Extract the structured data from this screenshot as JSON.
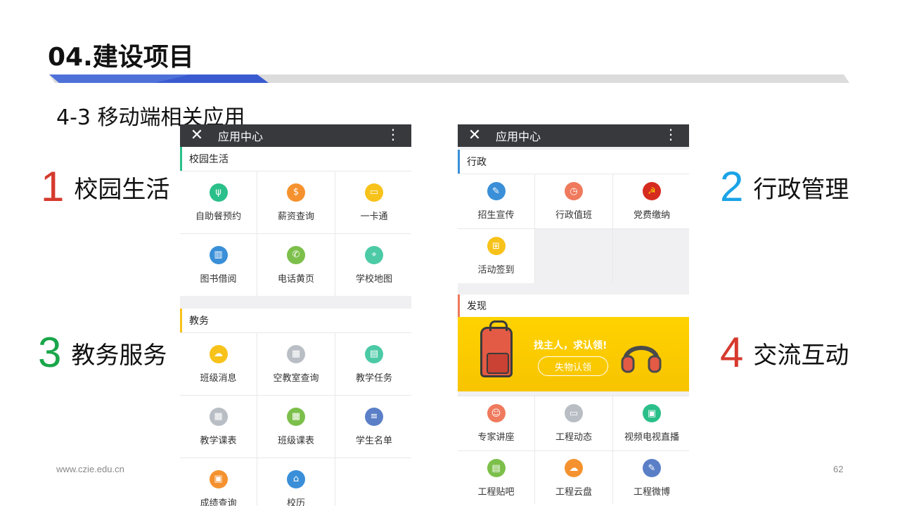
{
  "slide": {
    "title": "04.建设项目",
    "subtitle": "4-3 移动端相关应用",
    "footer_url": "www.czie.edu.cn",
    "page_number": "62"
  },
  "categories": [
    {
      "num": "1",
      "label": "校园生活",
      "color": "#d63a2e"
    },
    {
      "num": "2",
      "label": "行政管理",
      "color": "#1ba3e6"
    },
    {
      "num": "3",
      "label": "教务服务",
      "color": "#1aa64a"
    },
    {
      "num": "4",
      "label": "交流互动",
      "color": "#d63a2e"
    }
  ],
  "left_phone": {
    "header_title": "应用中心",
    "sections": [
      {
        "title": "校园生活",
        "accent": "#2bbf8a",
        "items": [
          {
            "label": "自助餐预约",
            "icon": "fork-icon",
            "color": "#2bbf8a"
          },
          {
            "label": "薪资查询",
            "icon": "coin-icon",
            "color": "#f5922f"
          },
          {
            "label": "一卡通",
            "icon": "card-icon",
            "color": "#f7c21a"
          },
          {
            "label": "图书借阅",
            "icon": "book-icon",
            "color": "#3a8fd8"
          },
          {
            "label": "电话黄页",
            "icon": "phone-icon",
            "color": "#7cbf4a"
          },
          {
            "label": "学校地图",
            "icon": "map-pin-icon",
            "color": "#4ccaa6"
          }
        ]
      },
      {
        "title": "教务",
        "accent": "#f7c21a",
        "items": [
          {
            "label": "班级消息",
            "icon": "chat-icon",
            "color": "#f7c21a"
          },
          {
            "label": "空教室查询",
            "icon": "building-icon",
            "color": "#b9bec5"
          },
          {
            "label": "教学任务",
            "icon": "clipboard-icon",
            "color": "#4ccaa6"
          },
          {
            "label": "教学课表",
            "icon": "table-icon",
            "color": "#b9bec5"
          },
          {
            "label": "班级课表",
            "icon": "calendar-icon",
            "color": "#7cbf4a"
          },
          {
            "label": "学生名单",
            "icon": "list-icon",
            "color": "#5a7fc7"
          },
          {
            "label": "成绩查询",
            "icon": "grade-icon",
            "color": "#f5922f"
          },
          {
            "label": "校历",
            "icon": "school-icon",
            "color": "#3a8fd8"
          }
        ]
      }
    ]
  },
  "right_phone": {
    "header_title": "应用中心",
    "admin_section": {
      "title": "行政",
      "accent": "#3a8fd8",
      "items": [
        {
          "label": "招生宣传",
          "icon": "pencil-icon",
          "color": "#3a8fd8"
        },
        {
          "label": "行政值班",
          "icon": "clock-icon",
          "color": "#ef7a5d"
        },
        {
          "label": "党费缴纳",
          "icon": "party-emblem-icon",
          "color": "#d62b1f"
        },
        {
          "label": "活动签到",
          "icon": "grid-icon",
          "color": "#f7c21a"
        }
      ]
    },
    "discover_section": {
      "title": "发现",
      "accent": "#ef7a5d",
      "banner_text": "找主人，求认领!",
      "banner_button": "失物认领",
      "items": [
        {
          "label": "专家讲座",
          "icon": "person-icon",
          "color": "#ef7a5d"
        },
        {
          "label": "工程动态",
          "icon": "monitor-icon",
          "color": "#b9bec5"
        },
        {
          "label": "视频电视直播",
          "icon": "tv-icon",
          "color": "#2bbf8a"
        },
        {
          "label": "工程贴吧",
          "icon": "post-icon",
          "color": "#7cbf4a"
        },
        {
          "label": "工程云盘",
          "icon": "cloud-icon",
          "color": "#f5922f"
        },
        {
          "label": "工程微博",
          "icon": "pen-icon",
          "color": "#5a7fc7"
        }
      ]
    }
  }
}
